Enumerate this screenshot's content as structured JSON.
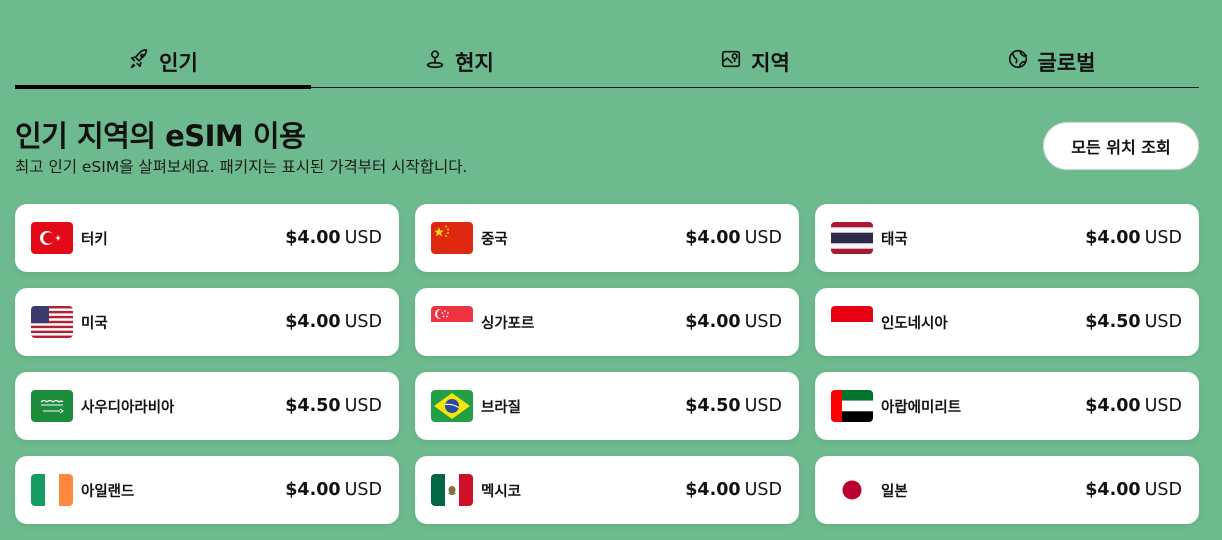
{
  "tabs": [
    {
      "label": "인기",
      "icon": "rocket-icon",
      "active": true
    },
    {
      "label": "현지",
      "icon": "location-pin-icon",
      "active": false
    },
    {
      "label": "지역",
      "icon": "map-icon",
      "active": false
    },
    {
      "label": "글로벌",
      "icon": "globe-icon",
      "active": false
    }
  ],
  "header": {
    "title": "인기 지역의 eSIM 이용",
    "subtitle": "최고 인기 eSIM을 살펴보세요. 패키지는 표시된 가격부터 시작합니다.",
    "view_all_label": "모든 위치 조회"
  },
  "destinations": [
    {
      "name": "터키",
      "price": "$4.00",
      "currency": "USD",
      "flag": "turkey"
    },
    {
      "name": "중국",
      "price": "$4.00",
      "currency": "USD",
      "flag": "china"
    },
    {
      "name": "태국",
      "price": "$4.00",
      "currency": "USD",
      "flag": "thailand"
    },
    {
      "name": "미국",
      "price": "$4.00",
      "currency": "USD",
      "flag": "usa"
    },
    {
      "name": "싱가포르",
      "price": "$4.00",
      "currency": "USD",
      "flag": "singapore"
    },
    {
      "name": "인도네시아",
      "price": "$4.50",
      "currency": "USD",
      "flag": "indonesia"
    },
    {
      "name": "사우디아라비아",
      "price": "$4.50",
      "currency": "USD",
      "flag": "saudi-arabia"
    },
    {
      "name": "브라질",
      "price": "$4.50",
      "currency": "USD",
      "flag": "brazil"
    },
    {
      "name": "아랍에미리트",
      "price": "$4.00",
      "currency": "USD",
      "flag": "uae"
    },
    {
      "name": "아일랜드",
      "price": "$4.00",
      "currency": "USD",
      "flag": "ireland"
    },
    {
      "name": "멕시코",
      "price": "$4.00",
      "currency": "USD",
      "flag": "mexico"
    },
    {
      "name": "일본",
      "price": "$4.00",
      "currency": "USD",
      "flag": "japan"
    }
  ],
  "colors": {
    "background": "#6cba8d",
    "card": "#ffffff",
    "text": "#111111"
  }
}
